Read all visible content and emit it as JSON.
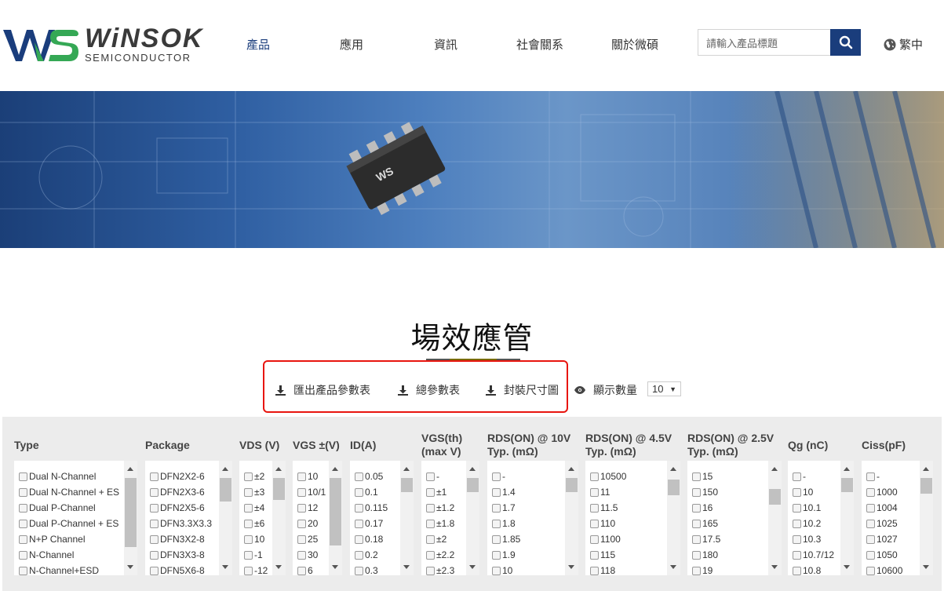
{
  "brand": {
    "name": "WiNSOK",
    "sub": "SEMICONDUCTOR"
  },
  "nav": [
    "產品",
    "應用",
    "資訊",
    "社會關系",
    "關於微碩"
  ],
  "search": {
    "placeholder": "請輸入產品標題"
  },
  "lang": "繁中",
  "page_title": "場效應管",
  "toolbar": {
    "export": "匯出產品參數表",
    "total": "總參數表",
    "package": "封裝尺寸圖",
    "show_count_label": "顯示數量",
    "show_count_value": "10"
  },
  "filters": [
    {
      "head": "Type",
      "options": [
        "Dual N-Channel",
        "Dual N-Channel + ES",
        "Dual P-Channel",
        "Dual P-Channel + ES",
        "N+P Channel",
        "N-Channel",
        "N-Channel+ESD"
      ]
    },
    {
      "head": "Package",
      "options": [
        "DFN2X2-6",
        "DFN2X3-6",
        "DFN2X5-6",
        "DFN3.3X3.3",
        "DFN3X2-8",
        "DFN3X3-8",
        "DFN5X6-8"
      ]
    },
    {
      "head": "VDS (V)",
      "options": [
        "±2",
        "±3",
        "±4",
        "±6",
        "10",
        "-1",
        "-12"
      ]
    },
    {
      "head": "VGS ±(V)",
      "options": [
        "10",
        "10/1",
        "12",
        "20",
        "25",
        "30",
        "6"
      ]
    },
    {
      "head": "ID(A)",
      "options": [
        "0.05",
        "0.1",
        "0.115",
        "0.17",
        "0.18",
        "0.2",
        "0.3"
      ]
    },
    {
      "head": "VGS(th)\n(max V)",
      "options": [
        "-",
        "±1",
        "±1.2",
        "±1.8",
        "±2",
        "±2.2",
        "±2.3"
      ]
    },
    {
      "head": "RDS(ON) @ 10V\nTyp. (mΩ)",
      "options": [
        "-",
        "1.4",
        "1.7",
        "1.8",
        "1.85",
        "1.9",
        "10"
      ]
    },
    {
      "head": "RDS(ON) @ 4.5V\nTyp. (mΩ)",
      "options": [
        "10500",
        "11",
        "11.5",
        "110",
        "1100",
        "115",
        "118"
      ]
    },
    {
      "head": "RDS(ON) @ 2.5V\nTyp. (mΩ)",
      "options": [
        "15",
        "150",
        "16",
        "165",
        "17.5",
        "180",
        "19"
      ]
    },
    {
      "head": "Qg (nC)",
      "options": [
        "-",
        "10",
        "10.1",
        "10.2",
        "10.3",
        "10.7/12",
        "10.8"
      ]
    },
    {
      "head": "Ciss(pF)",
      "options": [
        "-",
        "1000",
        "1004",
        "1025",
        "1027",
        "1050",
        "10600"
      ]
    }
  ]
}
